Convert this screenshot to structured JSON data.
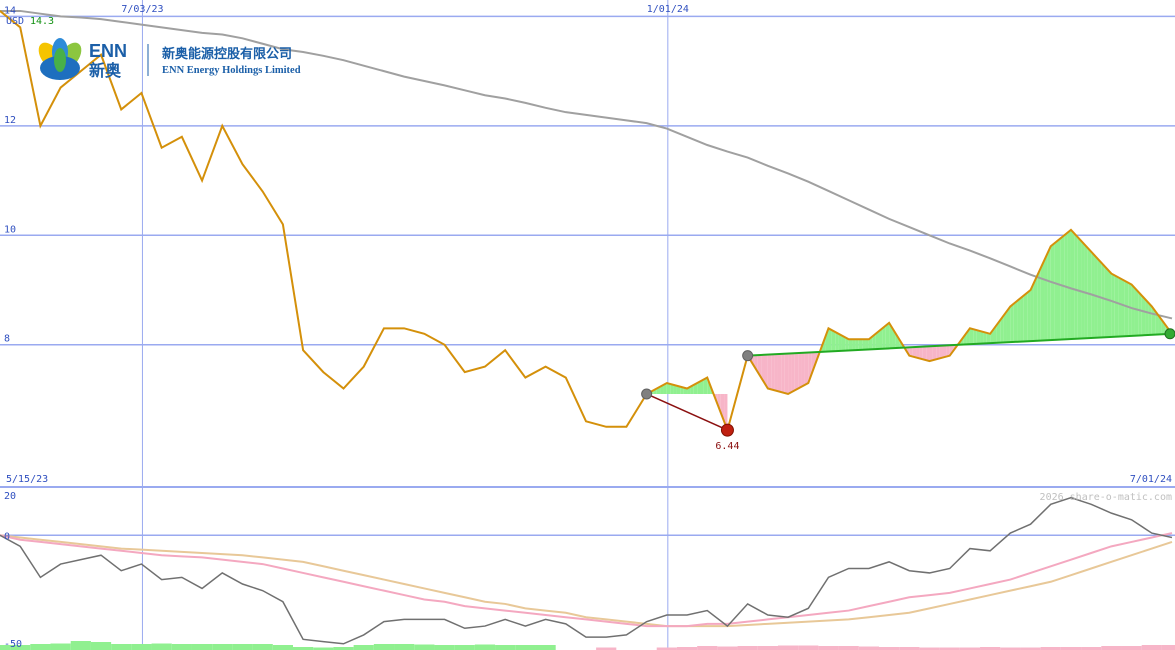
{
  "currency_label": "USD",
  "last_price": "14.3",
  "logo": {
    "brand_en": "ENN",
    "brand_zh": "新奥",
    "company_zh": "新奥能源控股有限公司",
    "company_en": "ENN Energy Holdings Limited"
  },
  "watermark": "2026 share-o-matic.com",
  "colors": {
    "price": "#d4900a",
    "sma": "#a0a0a0",
    "grid": "#9aaaf0",
    "gain_fill": "#90f090",
    "loss_fill": "#f7b5c8",
    "trend_up": "#22aa22",
    "trend_down": "#8b1010",
    "text_blue": "#3050c0",
    "text_green": "#109010",
    "osc_black": "#707070",
    "osc_pink": "#f4a8c0",
    "osc_tan": "#e8c898"
  },
  "chart_data": [
    {
      "type": "line",
      "ylim": [
        5.4,
        14.3
      ],
      "yticks": [
        "14",
        "12",
        "10",
        "8"
      ],
      "ytick_values": [
        14,
        12,
        10,
        8
      ],
      "x_top_labels": [
        "7/03/23",
        "1/01/24"
      ],
      "x_bottom_labels": [
        "5/15/23",
        "7/01/24"
      ],
      "week_range": [
        "5/15/23",
        "7/01/24"
      ],
      "series": [
        {
          "role": "price",
          "values": [
            14.1,
            13.8,
            12.0,
            12.7,
            13.0,
            13.3,
            12.3,
            12.6,
            11.6,
            11.8,
            11.0,
            12.0,
            11.3,
            10.8,
            10.2,
            7.9,
            7.5,
            7.2,
            7.6,
            8.3,
            8.3,
            8.2,
            8.0,
            7.5,
            7.6,
            7.9,
            7.4,
            7.6,
            7.4,
            6.6,
            6.5,
            6.5,
            7.1,
            7.3,
            7.2,
            7.4,
            6.44,
            7.8,
            7.2,
            7.1,
            7.3,
            8.3,
            8.1,
            8.1,
            8.4,
            7.8,
            7.7,
            7.8,
            8.3,
            8.2,
            8.7,
            9.0,
            9.8,
            10.1,
            9.7,
            9.3,
            9.1,
            8.7,
            8.2
          ]
        },
        {
          "role": "moving-average",
          "values": [
            14.1,
            14.1,
            14.05,
            14.0,
            13.98,
            13.95,
            13.9,
            13.85,
            13.8,
            13.75,
            13.7,
            13.67,
            13.6,
            13.5,
            13.4,
            13.35,
            13.28,
            13.2,
            13.1,
            13.0,
            12.9,
            12.82,
            12.74,
            12.65,
            12.56,
            12.5,
            12.42,
            12.33,
            12.25,
            12.2,
            12.15,
            12.1,
            12.05,
            11.95,
            11.8,
            11.65,
            11.53,
            11.42,
            11.27,
            11.13,
            10.98,
            10.81,
            10.64,
            10.47,
            10.3,
            10.15,
            10.0,
            9.85,
            9.72,
            9.58,
            9.43,
            9.28,
            9.15,
            9.03,
            8.92,
            8.8,
            8.67,
            8.57,
            8.48
          ]
        }
      ],
      "annotations": {
        "low_value": "6.44",
        "low_index": 36,
        "down_trend": {
          "from_index": 32,
          "to_index": 36
        },
        "up_trend": {
          "from_index": 37,
          "to_index": 58,
          "from_value": 7.8,
          "to_value": 8.2
        }
      }
    },
    {
      "type": "line",
      "ylim": [
        -50,
        20
      ],
      "yticks": [
        "20",
        "0",
        "-50"
      ],
      "ytick_values": [
        20,
        0,
        -50
      ],
      "series": [
        {
          "role": "oscillator",
          "values": [
            0,
            -5,
            -19,
            -13,
            -11,
            -9,
            -16,
            -13,
            -20,
            -19,
            -24,
            -17,
            -22,
            -25,
            -30,
            -47,
            -48,
            -49,
            -45,
            -39,
            -38,
            -38,
            -38,
            -42,
            -41,
            -38,
            -41,
            -38,
            -40,
            -46,
            -46,
            -45,
            -39,
            -36,
            -36,
            -34,
            -41,
            -31,
            -36,
            -37,
            -33,
            -19,
            -15,
            -15,
            -12,
            -16,
            -17,
            -15,
            -6,
            -7,
            1,
            5,
            14,
            17,
            14,
            10,
            7,
            1,
            -1
          ]
        },
        {
          "role": "signal-1",
          "values": [
            0,
            -2,
            -3,
            -4,
            -5,
            -6,
            -7,
            -8,
            -9,
            -9.5,
            -10,
            -11,
            -12,
            -13,
            -15,
            -17,
            -19,
            -21,
            -23,
            -25,
            -27,
            -29,
            -30,
            -32,
            -33,
            -34,
            -35,
            -36,
            -37,
            -38,
            -39,
            -40,
            -41,
            -41,
            -41,
            -40,
            -40,
            -39,
            -38,
            -37,
            -36,
            -35,
            -34,
            -32,
            -30,
            -28,
            -27,
            -26,
            -24,
            -22,
            -20,
            -17,
            -14,
            -11,
            -8,
            -5,
            -3,
            -1,
            1
          ]
        },
        {
          "role": "signal-2",
          "values": [
            0,
            -1,
            -2,
            -3,
            -4,
            -5,
            -6,
            -6.5,
            -7,
            -7.5,
            -8,
            -8.5,
            -9,
            -10,
            -11,
            -12,
            -14,
            -16,
            -18,
            -20,
            -22,
            -24,
            -26,
            -28,
            -30,
            -31,
            -33,
            -34,
            -35,
            -37,
            -38,
            -39,
            -40,
            -41,
            -41,
            -41,
            -41,
            -40.5,
            -40,
            -39.5,
            -39,
            -38.5,
            -38,
            -37,
            -36,
            -35,
            -33,
            -31,
            -29,
            -27,
            -25,
            -23,
            -21,
            -18,
            -15,
            -12,
            -9,
            -6,
            -3
          ]
        }
      ],
      "volume_bars": {
        "direction": [
          "up",
          "up",
          "up",
          "up",
          "up",
          "up",
          "up",
          "up",
          "up",
          "up",
          "up",
          "up",
          "up",
          "up",
          "up",
          "up",
          "up",
          "up",
          "up",
          "up",
          "up",
          "up",
          "up",
          "up",
          "up",
          "up",
          "up",
          "up",
          "none",
          "none",
          "down",
          "none",
          "none",
          "down",
          "down",
          "down",
          "down",
          "down",
          "down",
          "down",
          "down",
          "down",
          "down",
          "down",
          "down",
          "down",
          "down",
          "down",
          "down",
          "down",
          "down",
          "down",
          "down",
          "down",
          "down",
          "down",
          "down",
          "down",
          "down"
        ],
        "level": [
          1,
          1,
          1.2,
          1.3,
          1.8,
          1.6,
          1.2,
          1.2,
          1.3,
          1.2,
          1.2,
          1.2,
          1.2,
          1.2,
          1.0,
          0.6,
          0.5,
          0.6,
          1.0,
          1.2,
          1.2,
          1.1,
          1.0,
          1.0,
          1.1,
          1.0,
          1.0,
          1.0,
          0,
          0,
          0.5,
          0,
          0,
          0.5,
          0.6,
          0.8,
          0.7,
          0.8,
          0.8,
          0.9,
          0.9,
          0.8,
          0.8,
          0.7,
          0.6,
          0.6,
          0.5,
          0.5,
          0.5,
          0.6,
          0.5,
          0.5,
          0.6,
          0.6,
          0.6,
          0.8,
          0.8,
          1.0,
          1.0
        ]
      }
    }
  ]
}
